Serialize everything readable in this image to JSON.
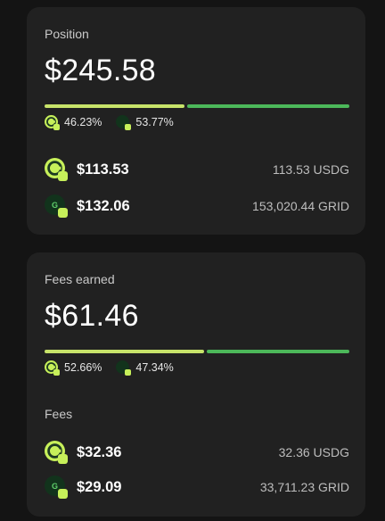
{
  "position": {
    "title": "Position",
    "total": "$245.58",
    "split": [
      {
        "token": "USDG",
        "pct": "46.23%",
        "fraction": 0.4623,
        "color": "#c7e36a"
      },
      {
        "token": "GRID",
        "pct": "53.77%",
        "fraction": 0.5377,
        "color": "#4cb85a"
      }
    ],
    "tokens": [
      {
        "symbol": "USDG",
        "icon": "usdg-icon",
        "usd": "$113.53",
        "amount": "113.53 USDG"
      },
      {
        "symbol": "GRID",
        "icon": "grid-icon",
        "usd": "$132.06",
        "amount": "153,020.44 GRID"
      }
    ]
  },
  "fees": {
    "title": "Fees earned",
    "total": "$61.46",
    "split": [
      {
        "token": "USDG",
        "pct": "52.66%",
        "fraction": 0.5266,
        "color": "#c7e36a"
      },
      {
        "token": "GRID",
        "pct": "47.34%",
        "fraction": 0.4734,
        "color": "#4cb85a"
      }
    ],
    "sub_label": "Fees",
    "tokens": [
      {
        "symbol": "USDG",
        "icon": "usdg-icon",
        "usd": "$32.36",
        "amount": "32.36 USDG"
      },
      {
        "symbol": "GRID",
        "icon": "grid-icon",
        "usd": "$29.09",
        "amount": "33,711.23 GRID"
      }
    ]
  }
}
